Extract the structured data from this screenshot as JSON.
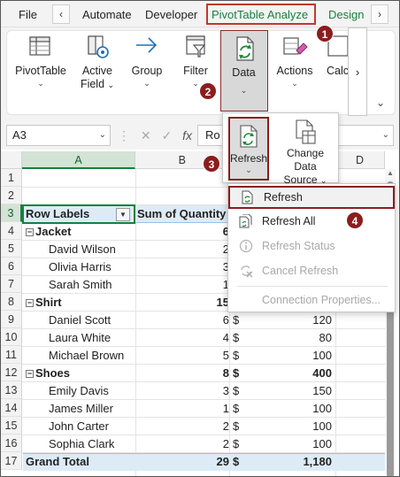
{
  "tabs": {
    "file": "File",
    "prev": "‹",
    "automate": "Automate",
    "developer": "Developer",
    "pivot_analyze": "PivotTable Analyze",
    "design": "Design",
    "next": "›"
  },
  "ribbon": {
    "pivottable": "PivotTable",
    "active_field_1": "Active",
    "active_field_2": "Field",
    "group": "Group",
    "filter": "Filter",
    "data": "Data",
    "actions": "Actions",
    "calc": "Calc",
    "chevron": "⌄"
  },
  "data_panel": {
    "refresh": "Refresh",
    "change_1": "Change Data",
    "change_2": "Source"
  },
  "formula_bar": {
    "name_box": "A3",
    "fx": "fx",
    "content": "Ro"
  },
  "columns": [
    "A",
    "B",
    "",
    "D"
  ],
  "rows": [
    {
      "num": "1",
      "a": "",
      "b": "",
      "c": ""
    },
    {
      "num": "2",
      "a": "",
      "b": "",
      "c": ""
    },
    {
      "num": "3",
      "a": "Row Labels",
      "b": "Sum of Quantity",
      "c": ""
    },
    {
      "num": "4",
      "a": "Jacket",
      "b": "6",
      "c": ""
    },
    {
      "num": "5",
      "a": "David Wilson",
      "b": "2",
      "c": ""
    },
    {
      "num": "6",
      "a": "Olivia Harris",
      "b": "3",
      "c": ""
    },
    {
      "num": "7",
      "a": "Sarah Smith",
      "b": "1",
      "c": ""
    },
    {
      "num": "8",
      "a": "Shirt",
      "b": "15",
      "c": ""
    },
    {
      "num": "9",
      "a": "Daniel Scott",
      "b": "6",
      "c_cur": "$",
      "c": "120"
    },
    {
      "num": "10",
      "a": "Laura White",
      "b": "4",
      "c_cur": "$",
      "c": "80"
    },
    {
      "num": "11",
      "a": "Michael Brown",
      "b": "5",
      "c_cur": "$",
      "c": "100"
    },
    {
      "num": "12",
      "a": "Shoes",
      "b": "8",
      "c_cur": "$",
      "c": "400"
    },
    {
      "num": "13",
      "a": "Emily Davis",
      "b": "3",
      "c_cur": "$",
      "c": "150"
    },
    {
      "num": "14",
      "a": "James Miller",
      "b": "1",
      "c_cur": "$",
      "c": "100"
    },
    {
      "num": "15",
      "a": "John Carter",
      "b": "2",
      "c_cur": "$",
      "c": "100"
    },
    {
      "num": "16",
      "a": "Sophia Clark",
      "b": "2",
      "c_cur": "$",
      "c": "100"
    },
    {
      "num": "17",
      "a": "Grand Total",
      "b": "29",
      "c_cur": "$",
      "c": "1,180"
    }
  ],
  "refresh_menu": {
    "refresh": "Refresh",
    "refresh_all": "Refresh All",
    "refresh_status": "Refresh Status",
    "cancel_refresh": "Cancel Refresh",
    "connection_properties": "Connection Properties..."
  },
  "badges": {
    "b1": "1",
    "b2": "2",
    "b3": "3",
    "b4": "4"
  },
  "colors": {
    "accent_green": "#17803e",
    "badge": "#8b1d1d",
    "pivot_header": "#ddebf7"
  }
}
